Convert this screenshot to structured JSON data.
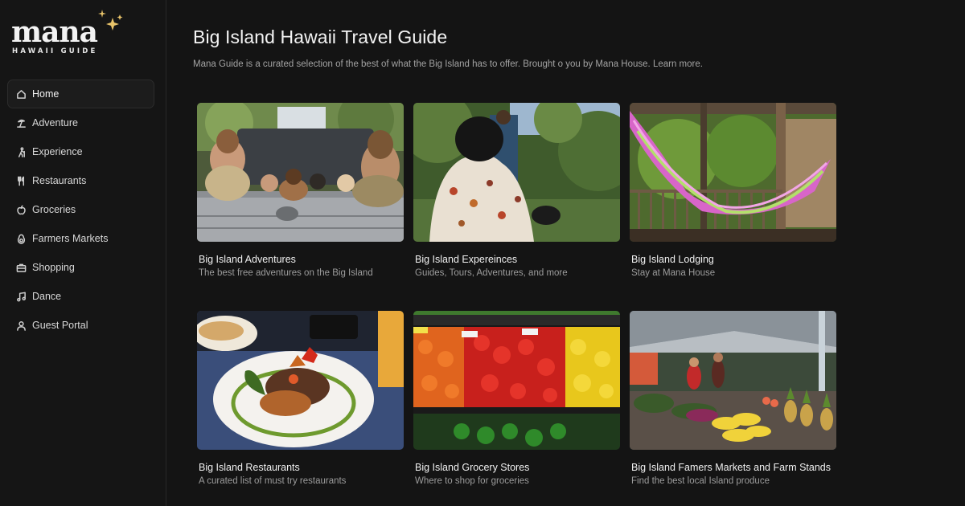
{
  "brand": {
    "name": "mana",
    "tagline": "HAWAII GUIDE"
  },
  "sidebar": {
    "items": [
      {
        "label": "Home",
        "icon": "home-icon",
        "active": true
      },
      {
        "label": "Adventure",
        "icon": "beach-icon",
        "active": false
      },
      {
        "label": "Experience",
        "icon": "hiker-icon",
        "active": false
      },
      {
        "label": "Restaurants",
        "icon": "utensils-icon",
        "active": false
      },
      {
        "label": "Groceries",
        "icon": "apple-icon",
        "active": false
      },
      {
        "label": "Farmers Markets",
        "icon": "avocado-icon",
        "active": false
      },
      {
        "label": "Shopping",
        "icon": "briefcase-icon",
        "active": false
      },
      {
        "label": "Dance",
        "icon": "music-note-icon",
        "active": false
      },
      {
        "label": "Guest Portal",
        "icon": "user-icon",
        "active": false
      }
    ]
  },
  "main": {
    "title": "Big Island Hawaii Travel Guide",
    "description": "Mana Guide is a curated selection of  the best of what the Big Island has to offer. Brought o you by Mana House. Learn more."
  },
  "cards": [
    {
      "title": "Big Island Adventures",
      "subtitle": "The best free adventures on the Big Island"
    },
    {
      "title": "Big Island Expereinces",
      "subtitle": "Guides, Tours, Adventures, and more"
    },
    {
      "title": "Big Island Lodging",
      "subtitle": "Stay at Mana House"
    },
    {
      "title": "Big Island Restaurants",
      "subtitle": "A curated list of must try restaurants"
    },
    {
      "title": "Big Island Grocery Stores",
      "subtitle": "Where to shop for groceries"
    },
    {
      "title": "Big Island Famers Markets and Farm Stands",
      "subtitle": "Find the best local Island produce"
    }
  ],
  "colors": {
    "background": "#141414",
    "sidebar": "#151515",
    "accent_sparkle": "#e9c46a"
  }
}
